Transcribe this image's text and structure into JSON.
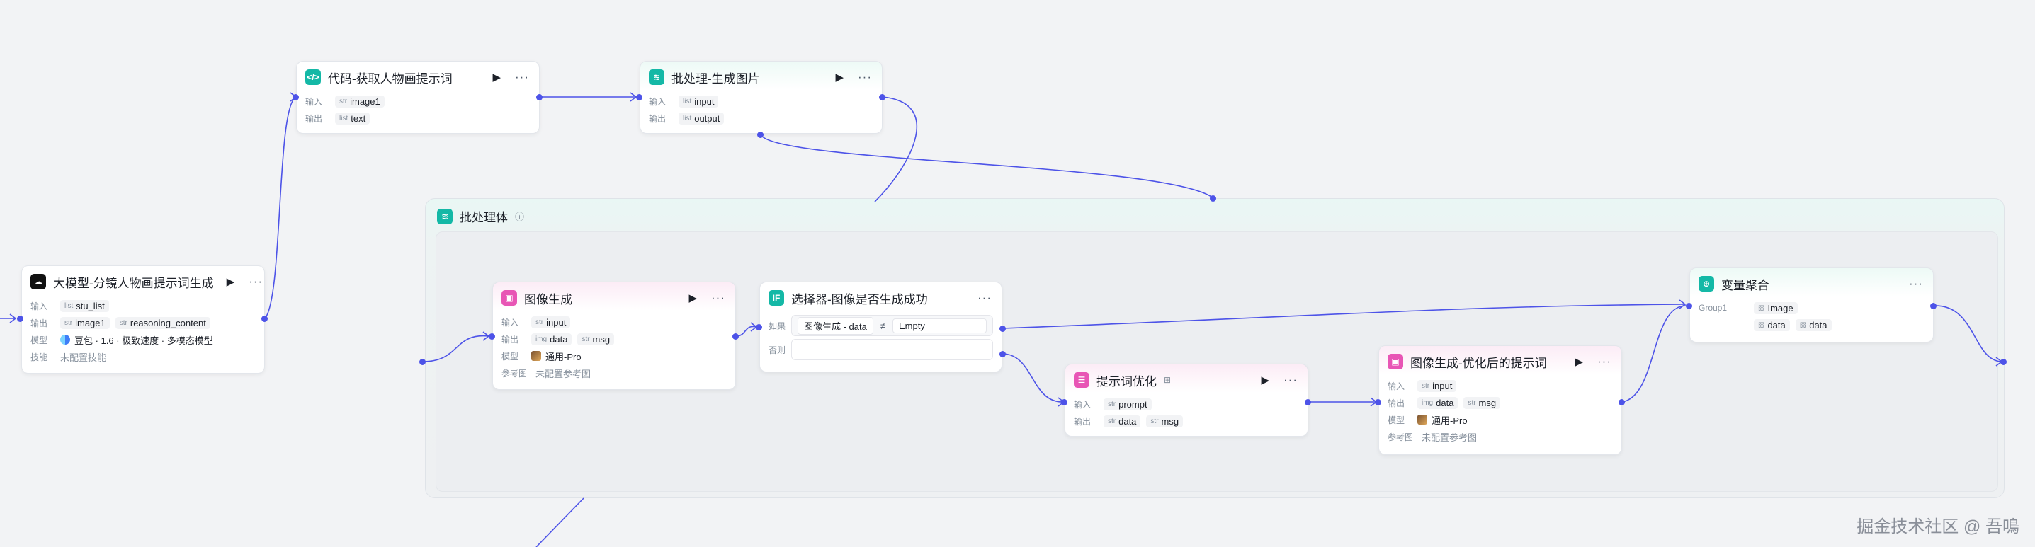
{
  "group": {
    "title": "批处理体"
  },
  "labels": {
    "input": "输入",
    "output": "输出",
    "model": "模型",
    "skill": "技能",
    "ref_image": "参考图",
    "if_label": "如果",
    "else_label": "否则",
    "group_label": "Group1"
  },
  "types": {
    "str": "str",
    "list": "list",
    "img": "img"
  },
  "nodes": {
    "llm": {
      "title": "大模型-分镜人物画提示词生成",
      "input": "stu_list",
      "outputs": [
        "image1",
        "reasoning_content"
      ],
      "model": "豆包 · 1.6 · 极致速度 · 多模态模型",
      "skill": "未配置技能"
    },
    "code": {
      "title": "代码-获取人物画提示词",
      "input": "image1",
      "output": "text"
    },
    "batch": {
      "title": "批处理-生成图片",
      "input": "input",
      "output": "output"
    },
    "imggen": {
      "title": "图像生成",
      "input": "input",
      "outputs": [
        "data",
        "msg"
      ],
      "model": "通用-Pro",
      "ref": "未配置参考图"
    },
    "selector": {
      "title": "选择器-图像是否生成成功",
      "cond_left": "图像生成 - data",
      "cond_op": "≠",
      "cond_right": "Empty"
    },
    "prompt_opt": {
      "title": "提示词优化",
      "input": "prompt",
      "outputs": [
        "data",
        "msg"
      ]
    },
    "imggen2": {
      "title": "图像生成-优化后的提示词",
      "input": "input",
      "outputs": [
        "data",
        "msg"
      ],
      "model": "通用-Pro",
      "ref": "未配置参考图"
    },
    "aggregate": {
      "title": "变量聚合",
      "group_items": [
        "Image"
      ],
      "items": [
        "data",
        "data"
      ]
    }
  },
  "watermark": "掘金技术社区 @ 吾鳴",
  "colors": {
    "edge": "#4d53e8",
    "teal": "#14b8a6",
    "pink": "#e855b5"
  }
}
